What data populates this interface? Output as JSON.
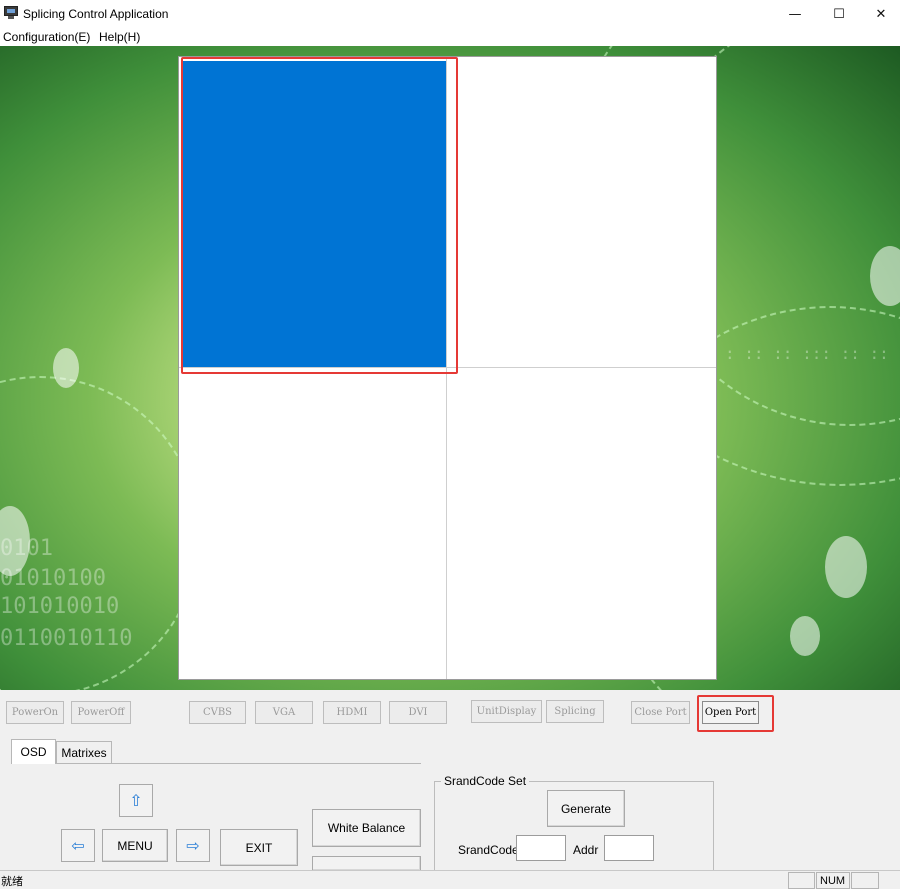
{
  "window": {
    "title": "Splicing Control Application",
    "minimize": "—",
    "maximize": "☐",
    "close": "✕"
  },
  "menu": {
    "items": [
      "Configuration(E)",
      "Help(H)"
    ]
  },
  "colors": {
    "selected_cell": "#0074d4",
    "highlight": "#e53935"
  },
  "wall": {
    "rows": 2,
    "cols": 2,
    "selected_cell": 1
  },
  "toolbar": {
    "buttons": [
      {
        "label": "PowerOn",
        "enabled": false
      },
      {
        "label": "PowerOff",
        "enabled": false
      },
      {
        "label": "CVBS",
        "enabled": false
      },
      {
        "label": "VGA",
        "enabled": false
      },
      {
        "label": "HDMI",
        "enabled": false
      },
      {
        "label": "DVI",
        "enabled": false
      },
      {
        "label": "UnitDisplay",
        "enabled": false
      },
      {
        "label": "Splicing",
        "enabled": false
      },
      {
        "label": "Close Port",
        "enabled": false
      },
      {
        "label": "Open Port",
        "enabled": true
      }
    ]
  },
  "tabs": [
    {
      "label": "OSD",
      "active": true
    },
    {
      "label": "Matrixes",
      "active": false
    }
  ],
  "osd": {
    "up_icon": "arrow-up-icon",
    "left_icon": "arrow-left-icon",
    "right_icon": "arrow-right-icon",
    "menu_label": "MENU",
    "exit_label": "EXIT",
    "white_balance_label": "White Balance"
  },
  "srand": {
    "title": "SrandCode Set",
    "generate_label": "Generate",
    "code_label": "SrandCode",
    "addr_label": "Addr",
    "code_value": "",
    "addr_value": ""
  },
  "status": {
    "text": "就绪",
    "num": "NUM"
  }
}
